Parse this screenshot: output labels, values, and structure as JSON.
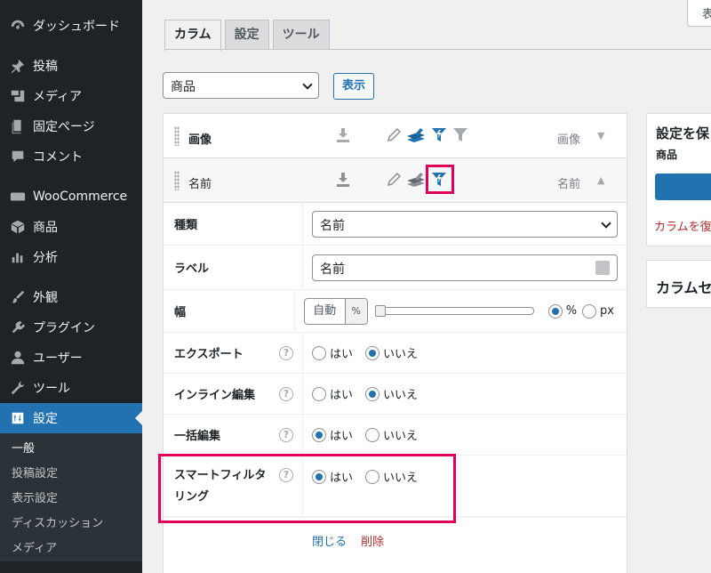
{
  "sidebar": {
    "items": [
      {
        "label": "ダッシュボード",
        "icon": "dashboard-icon"
      },
      {
        "label": "投稿",
        "icon": "pin-icon"
      },
      {
        "label": "メディア",
        "icon": "media-icon"
      },
      {
        "label": "固定ページ",
        "icon": "page-icon"
      },
      {
        "label": "コメント",
        "icon": "comment-icon"
      },
      {
        "label": "WooCommerce",
        "icon": "woo-icon"
      },
      {
        "label": "商品",
        "icon": "box-icon"
      },
      {
        "label": "分析",
        "icon": "chart-icon"
      },
      {
        "label": "外観",
        "icon": "brush-icon"
      },
      {
        "label": "プラグイン",
        "icon": "plugin-icon"
      },
      {
        "label": "ユーザー",
        "icon": "user-icon"
      },
      {
        "label": "ツール",
        "icon": "wrench-icon"
      },
      {
        "label": "設定",
        "icon": "settings-icon"
      }
    ],
    "submenu": [
      "一般",
      "投稿設定",
      "表示設定",
      "ディスカッション",
      "メディア"
    ]
  },
  "help_tab_label": "表",
  "tabs": [
    "カラム",
    "設定",
    "ツール"
  ],
  "type_select": {
    "value": "商品"
  },
  "show_button": "表示",
  "columns": [
    {
      "title": "画像",
      "type": "画像"
    },
    {
      "title": "名前",
      "type": "名前"
    }
  ],
  "settings": {
    "type_label": "種類",
    "type_value": "名前",
    "label_label": "ラベル",
    "label_value": "名前",
    "width_label": "幅",
    "width_auto": "自動",
    "width_unit": "%",
    "unit_percent": "%",
    "unit_px": "px",
    "export_label": "エクスポート",
    "inline_label": "インライン編集",
    "bulk_label": "一括編集",
    "smart_label": "スマートフィルタリング",
    "yes": "はい",
    "no": "いいえ",
    "close_link": "閉じる",
    "delete_link": "削除",
    "help": "?"
  },
  "side_box_1": {
    "title": "設定を保",
    "subtitle": "商品",
    "restore_link": "カラムを復"
  },
  "side_box_2": {
    "title": "カラムセ"
  },
  "colors": {
    "accent": "#2271b1",
    "highlight": "#e0005a",
    "sidebar": "#1d2327"
  }
}
